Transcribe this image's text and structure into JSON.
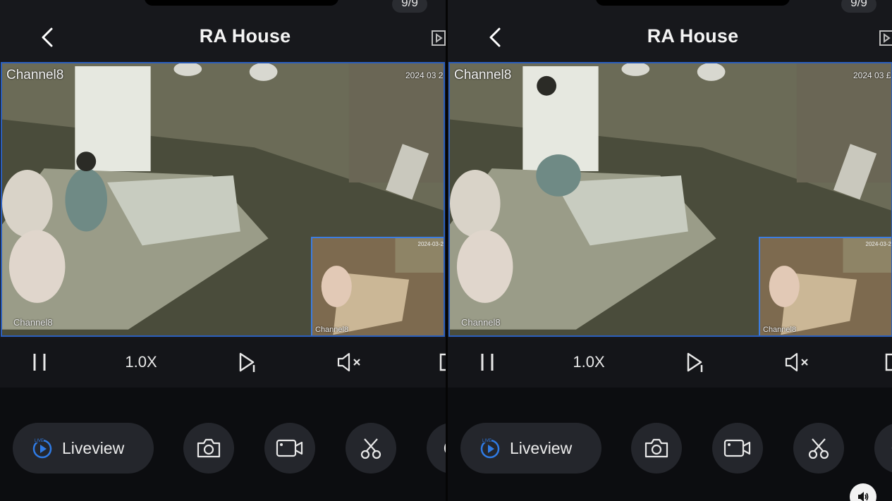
{
  "header": {
    "title": "RA House",
    "page_counter": "9/9"
  },
  "video": {
    "channel_label": "Channel8",
    "channel_label_bottom": "Channel8",
    "timestamp_left": "2024 03 2",
    "timestamp_right": "2024 03 £",
    "pip_timestamp": "2024-03-2",
    "pip_channel_label": "Channel8"
  },
  "controls": {
    "speed": "1.0X"
  },
  "toolbar": {
    "liveview_label": "Liveview"
  },
  "colors": {
    "accent": "#2f7be5",
    "panel": "#17181c",
    "button": "#24262c"
  },
  "icons": [
    "back-icon",
    "playback-icon",
    "pause-icon",
    "play-next-icon",
    "mute-icon",
    "fullscreen-icon",
    "live-icon",
    "camera-icon",
    "video-record-icon",
    "scissors-icon",
    "more-icon",
    "sound-icon"
  ]
}
